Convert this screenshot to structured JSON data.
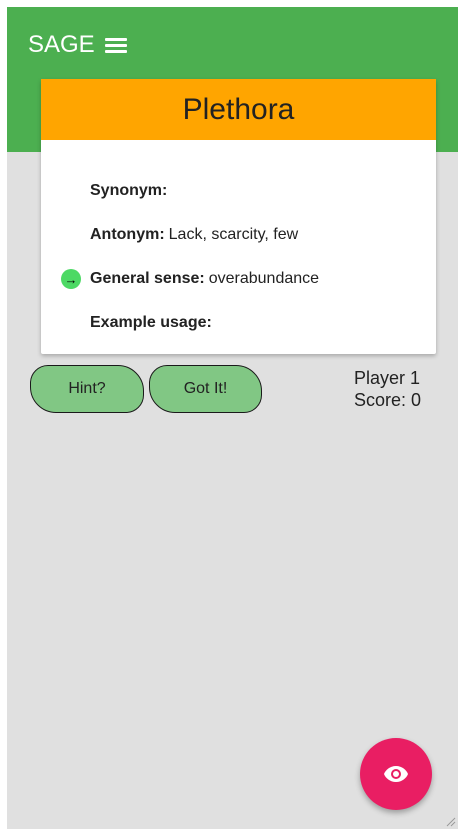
{
  "app": {
    "title": "SAGE"
  },
  "card": {
    "word": "Plethora",
    "rows": [
      {
        "label": "Synonym:",
        "value": "",
        "active": false
      },
      {
        "label": "Antonym:",
        "value": "Lack, scarcity, few",
        "active": false
      },
      {
        "label": "General sense:",
        "value": "overabundance",
        "active": true
      },
      {
        "label": "Example usage:",
        "value": "",
        "active": false
      }
    ],
    "active_marker": "→"
  },
  "buttons": {
    "hint": "Hint?",
    "got_it": "Got It!"
  },
  "player": {
    "name": "Player 1",
    "score": "Score: 0"
  },
  "icons": {
    "menu": "hamburger-menu-icon",
    "fab": "eye-icon",
    "marker": "arrow-right-icon"
  },
  "colors": {
    "header": "#4caf50",
    "card_header": "#ffa500",
    "button": "#81c784",
    "fab": "#e91e63",
    "marker": "#4cd964",
    "background": "#e0e0e0"
  }
}
